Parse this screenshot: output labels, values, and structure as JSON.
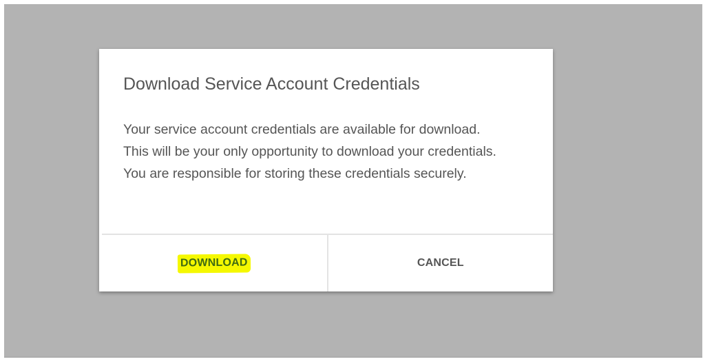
{
  "dialog": {
    "title": "Download Service Account Credentials",
    "body": "Your service account credentials are available for download. This will be your only opportunity to download your credentials. You are responsible for storing these credentials securely.",
    "download_label": "DOWNLOAD",
    "cancel_label": "CANCEL",
    "highlight_color": "#f5f800",
    "backdrop_color": "#b3b3b3"
  }
}
